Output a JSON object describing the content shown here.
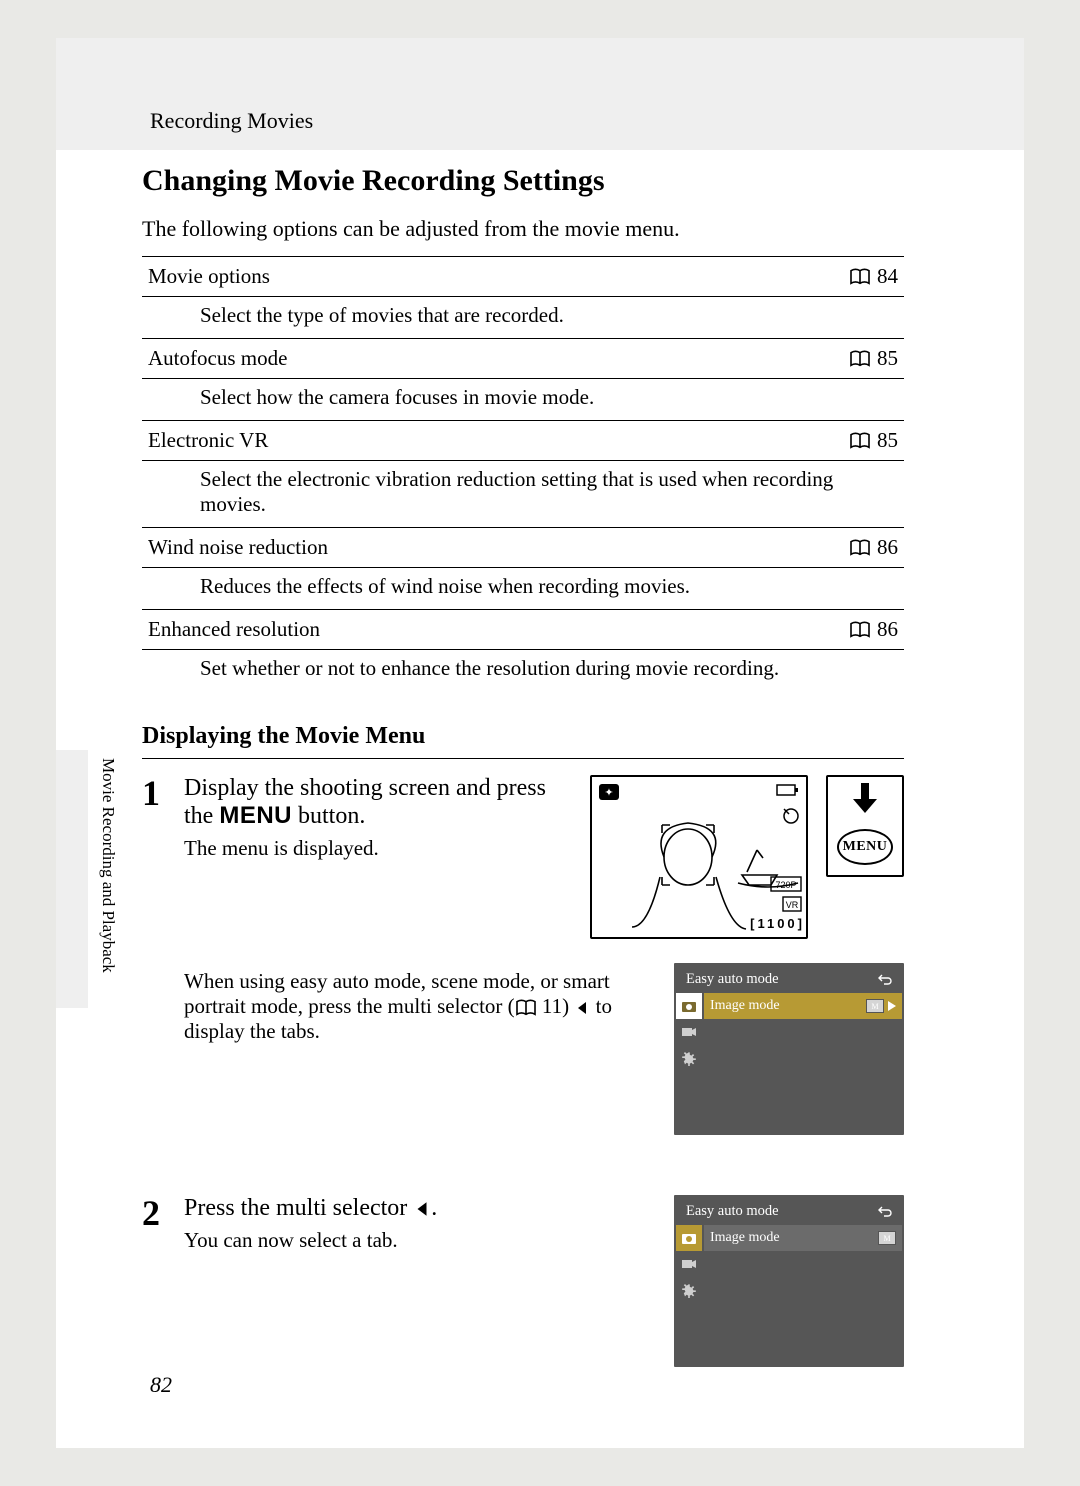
{
  "header": {
    "section": "Recording Movies"
  },
  "title": "Changing Movie Recording Settings",
  "intro": "The following options can be adjusted from the movie menu.",
  "options": [
    {
      "name": "Movie options",
      "page": "84",
      "desc": "Select the type of movies that are recorded."
    },
    {
      "name": "Autofocus mode",
      "page": "85",
      "desc": "Select how the camera focuses in movie mode."
    },
    {
      "name": "Electronic VR",
      "page": "85",
      "desc": "Select the electronic vibration reduction setting that is used when recording movies."
    },
    {
      "name": "Wind noise reduction",
      "page": "86",
      "desc": "Reduces the effects of wind noise when recording movies."
    },
    {
      "name": "Enhanced resolution",
      "page": "86",
      "desc": "Set whether or not to enhance the resolution during movie recording."
    }
  ],
  "subheading": "Displaying the Movie Menu",
  "steps": {
    "s1": {
      "num": "1",
      "title_a": "Display the shooting screen and press the ",
      "menu_word": "MENU",
      "title_b": " button.",
      "note": "The menu is displayed.",
      "extra_a": "When using easy auto mode, scene mode, or smart portrait mode, press the multi selector (",
      "extra_ref": "11",
      "extra_b": ") ",
      "extra_c": " to display the tabs."
    },
    "s2": {
      "num": "2",
      "title": "Press the multi selector ",
      "title_end": ".",
      "note": "You can now select a tab."
    }
  },
  "menu_screen": {
    "title": "Easy auto mode",
    "item": "Image mode"
  },
  "shoot_overlay": {
    "count": "1100"
  },
  "menu_button_label": "MENU",
  "side_tab_text": "Movie Recording and Playback",
  "page_number": "82"
}
